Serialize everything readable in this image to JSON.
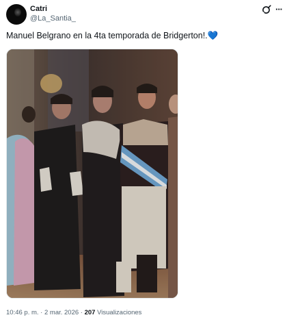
{
  "author": {
    "display_name": "Catri",
    "handle": "@La_Santia_"
  },
  "icons": {
    "grok": "grok-icon",
    "more": "more-icon",
    "heart": "blue-heart-icon"
  },
  "tweet": {
    "text": "Manuel Belgrano en la 4ta temporada de Bridgerton!.",
    "heart_emoji": "💙"
  },
  "meta": {
    "time": "10:46 p. m.",
    "separator_1": " · ",
    "date": "2 mar. 2026",
    "separator_2": " · ",
    "views_count": "207",
    "views_label": " Visualizaciones"
  },
  "colors": {
    "text_primary": "#0f1419",
    "text_secondary": "#536471",
    "heart": "#4ea6e8"
  }
}
